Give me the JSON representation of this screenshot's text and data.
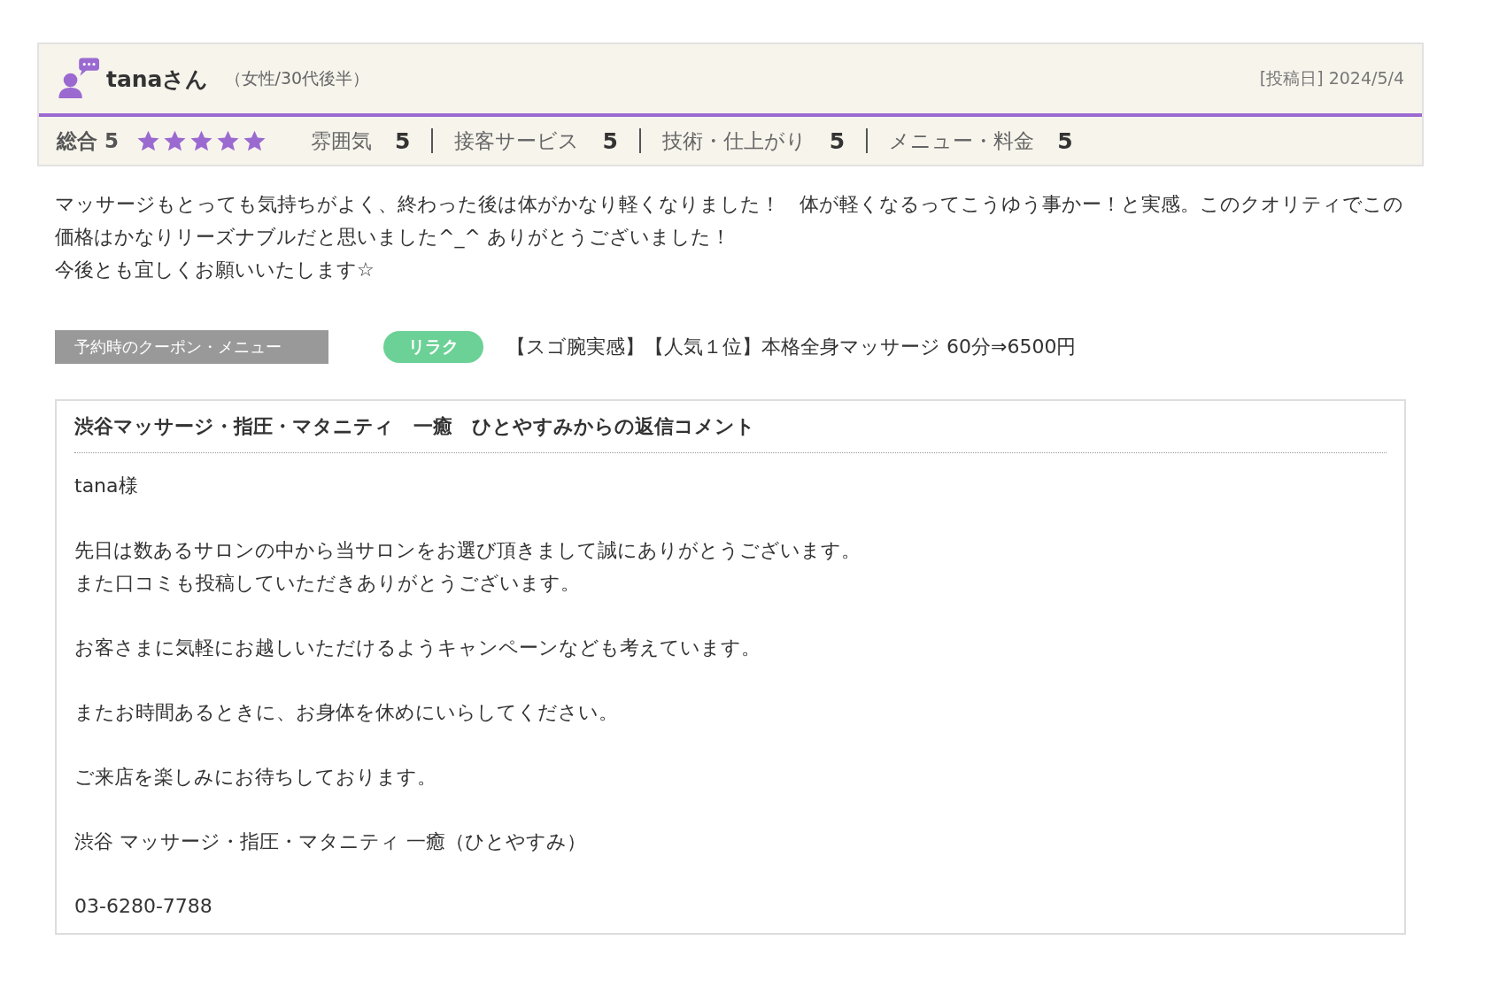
{
  "review": {
    "author": "tanaさん",
    "demographic": "（女性/30代後半）",
    "posted": "[投稿日] 2024/5/4",
    "overall": {
      "label": "総合",
      "value": "5",
      "stars": 5
    },
    "ratings": [
      {
        "label": "雰囲気",
        "value": "5"
      },
      {
        "label": "接客サービス",
        "value": "5"
      },
      {
        "label": "技術・仕上がり",
        "value": "5"
      },
      {
        "label": "メニュー・料金",
        "value": "5"
      }
    ],
    "body": [
      "マッサージもとっても気持ちがよく、終わった後は体がかなり軽くなりました！　体が軽くなるってこうゆう事かー！と実感。このクオリティでこの価格はかなりリーズナブルだと思いました^_^ ありがとうございました！",
      "今後とも宜しくお願いいたします☆"
    ],
    "coupon": {
      "label": "予約時のクーポン・メニュー",
      "tag": "リラク",
      "text": "【スゴ腕実感】【人気１位】本格全身マッサージ 60分⇒6500円"
    },
    "reply": {
      "title": "渋谷マッサージ・指圧・マタニティ　一癒　ひとやすみからの返信コメント",
      "paragraphs": [
        [
          "tana様"
        ],
        [
          "先日は数あるサロンの中から当サロンをお選び頂きまして誠にありがとうございます。",
          "また口コミも投稿していただきありがとうございます。"
        ],
        [
          "お客さまに気軽にお越しいただけるようキャンペーンなども考えています。"
        ],
        [
          "またお時間あるときに、お身体を休めにいらしてください。"
        ],
        [
          "ご来店を楽しみにお待ちしております。"
        ],
        [
          "渋谷 マッサージ・指圧・マタニティ 一癒（ひとやすみ）"
        ],
        [
          "03-6280-7788"
        ]
      ]
    }
  }
}
